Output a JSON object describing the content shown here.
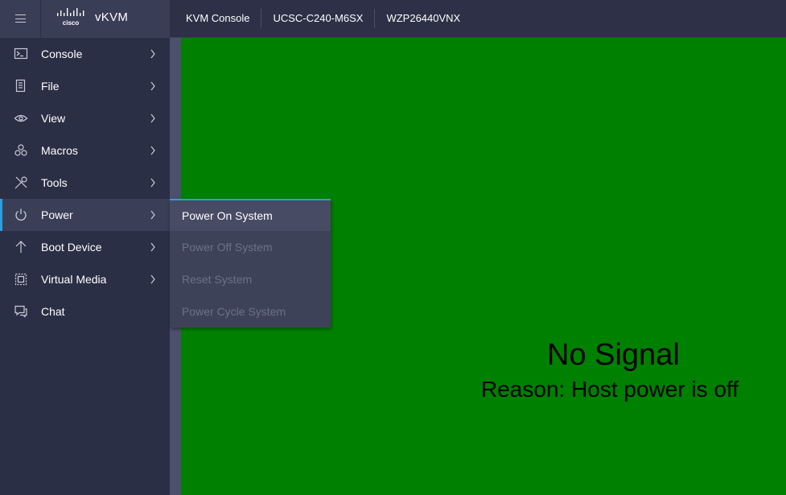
{
  "header": {
    "app_title": "vKVM",
    "logo_text": "cisco",
    "tabs": [
      "KVM Console",
      "UCSC-C240-M6SX",
      "WZP26440VNX"
    ]
  },
  "sidebar": {
    "items": [
      {
        "label": "Console",
        "icon": "console-icon",
        "has_submenu": true
      },
      {
        "label": "File",
        "icon": "file-icon",
        "has_submenu": true
      },
      {
        "label": "View",
        "icon": "eye-icon",
        "has_submenu": true
      },
      {
        "label": "Macros",
        "icon": "macros-icon",
        "has_submenu": true
      },
      {
        "label": "Tools",
        "icon": "tools-icon",
        "has_submenu": true
      },
      {
        "label": "Power",
        "icon": "power-icon",
        "has_submenu": true,
        "active": true
      },
      {
        "label": "Boot Device",
        "icon": "boot-device-icon",
        "has_submenu": true
      },
      {
        "label": "Virtual Media",
        "icon": "virtual-media-icon",
        "has_submenu": true
      },
      {
        "label": "Chat",
        "icon": "chat-icon",
        "has_submenu": false
      }
    ]
  },
  "power_submenu": {
    "items": [
      {
        "label": "Power On System",
        "enabled": true
      },
      {
        "label": "Power Off System",
        "enabled": false
      },
      {
        "label": "Reset System",
        "enabled": false
      },
      {
        "label": "Power Cycle System",
        "enabled": false
      }
    ]
  },
  "console": {
    "message": "No Signal",
    "reason": "Reason: Host power is off",
    "background_color": "#008000"
  },
  "colors": {
    "accent": "#2a9fe0",
    "sidebar_bg": "#2b2f45",
    "submenu_bg": "#3e4259"
  }
}
